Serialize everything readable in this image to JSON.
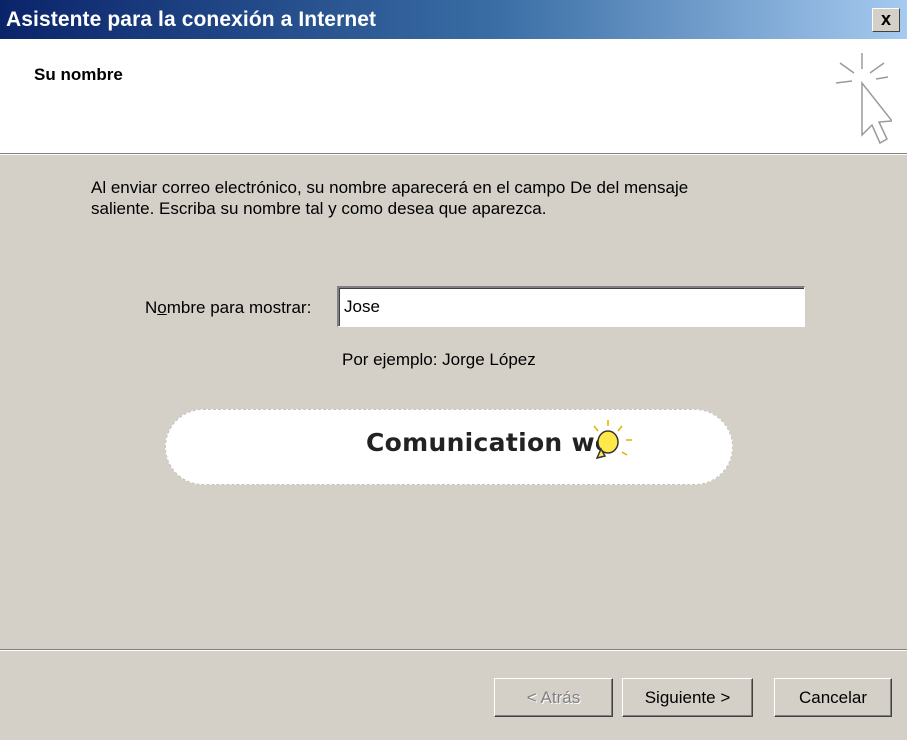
{
  "window": {
    "title": "Asistente para la conexión a Internet",
    "close_label": "x"
  },
  "header": {
    "title": "Su nombre"
  },
  "description": {
    "line1": "Al enviar correo electrónico, su nombre aparecerá en el campo De del mensaje",
    "line2": "saliente. Escriba su nombre tal y como desea que aparezca."
  },
  "form": {
    "label_prefix": "N",
    "label_accel": "o",
    "label_suffix": "mbre para mostrar:",
    "value": "Jose",
    "example": "Por ejemplo: Jorge López"
  },
  "banner": {
    "text": "Comunication we"
  },
  "buttons": {
    "back": "< Atrás",
    "next": "Siguiente >",
    "cancel": "Cancelar"
  },
  "colors": {
    "titlebar_start": "#0a246a",
    "titlebar_end": "#a6caf0",
    "face": "#d4d0c8",
    "header_bg": "#ffffff"
  },
  "icons": {
    "header": "cursor-sparkle-icon",
    "banner": "lightbulb-icon"
  }
}
